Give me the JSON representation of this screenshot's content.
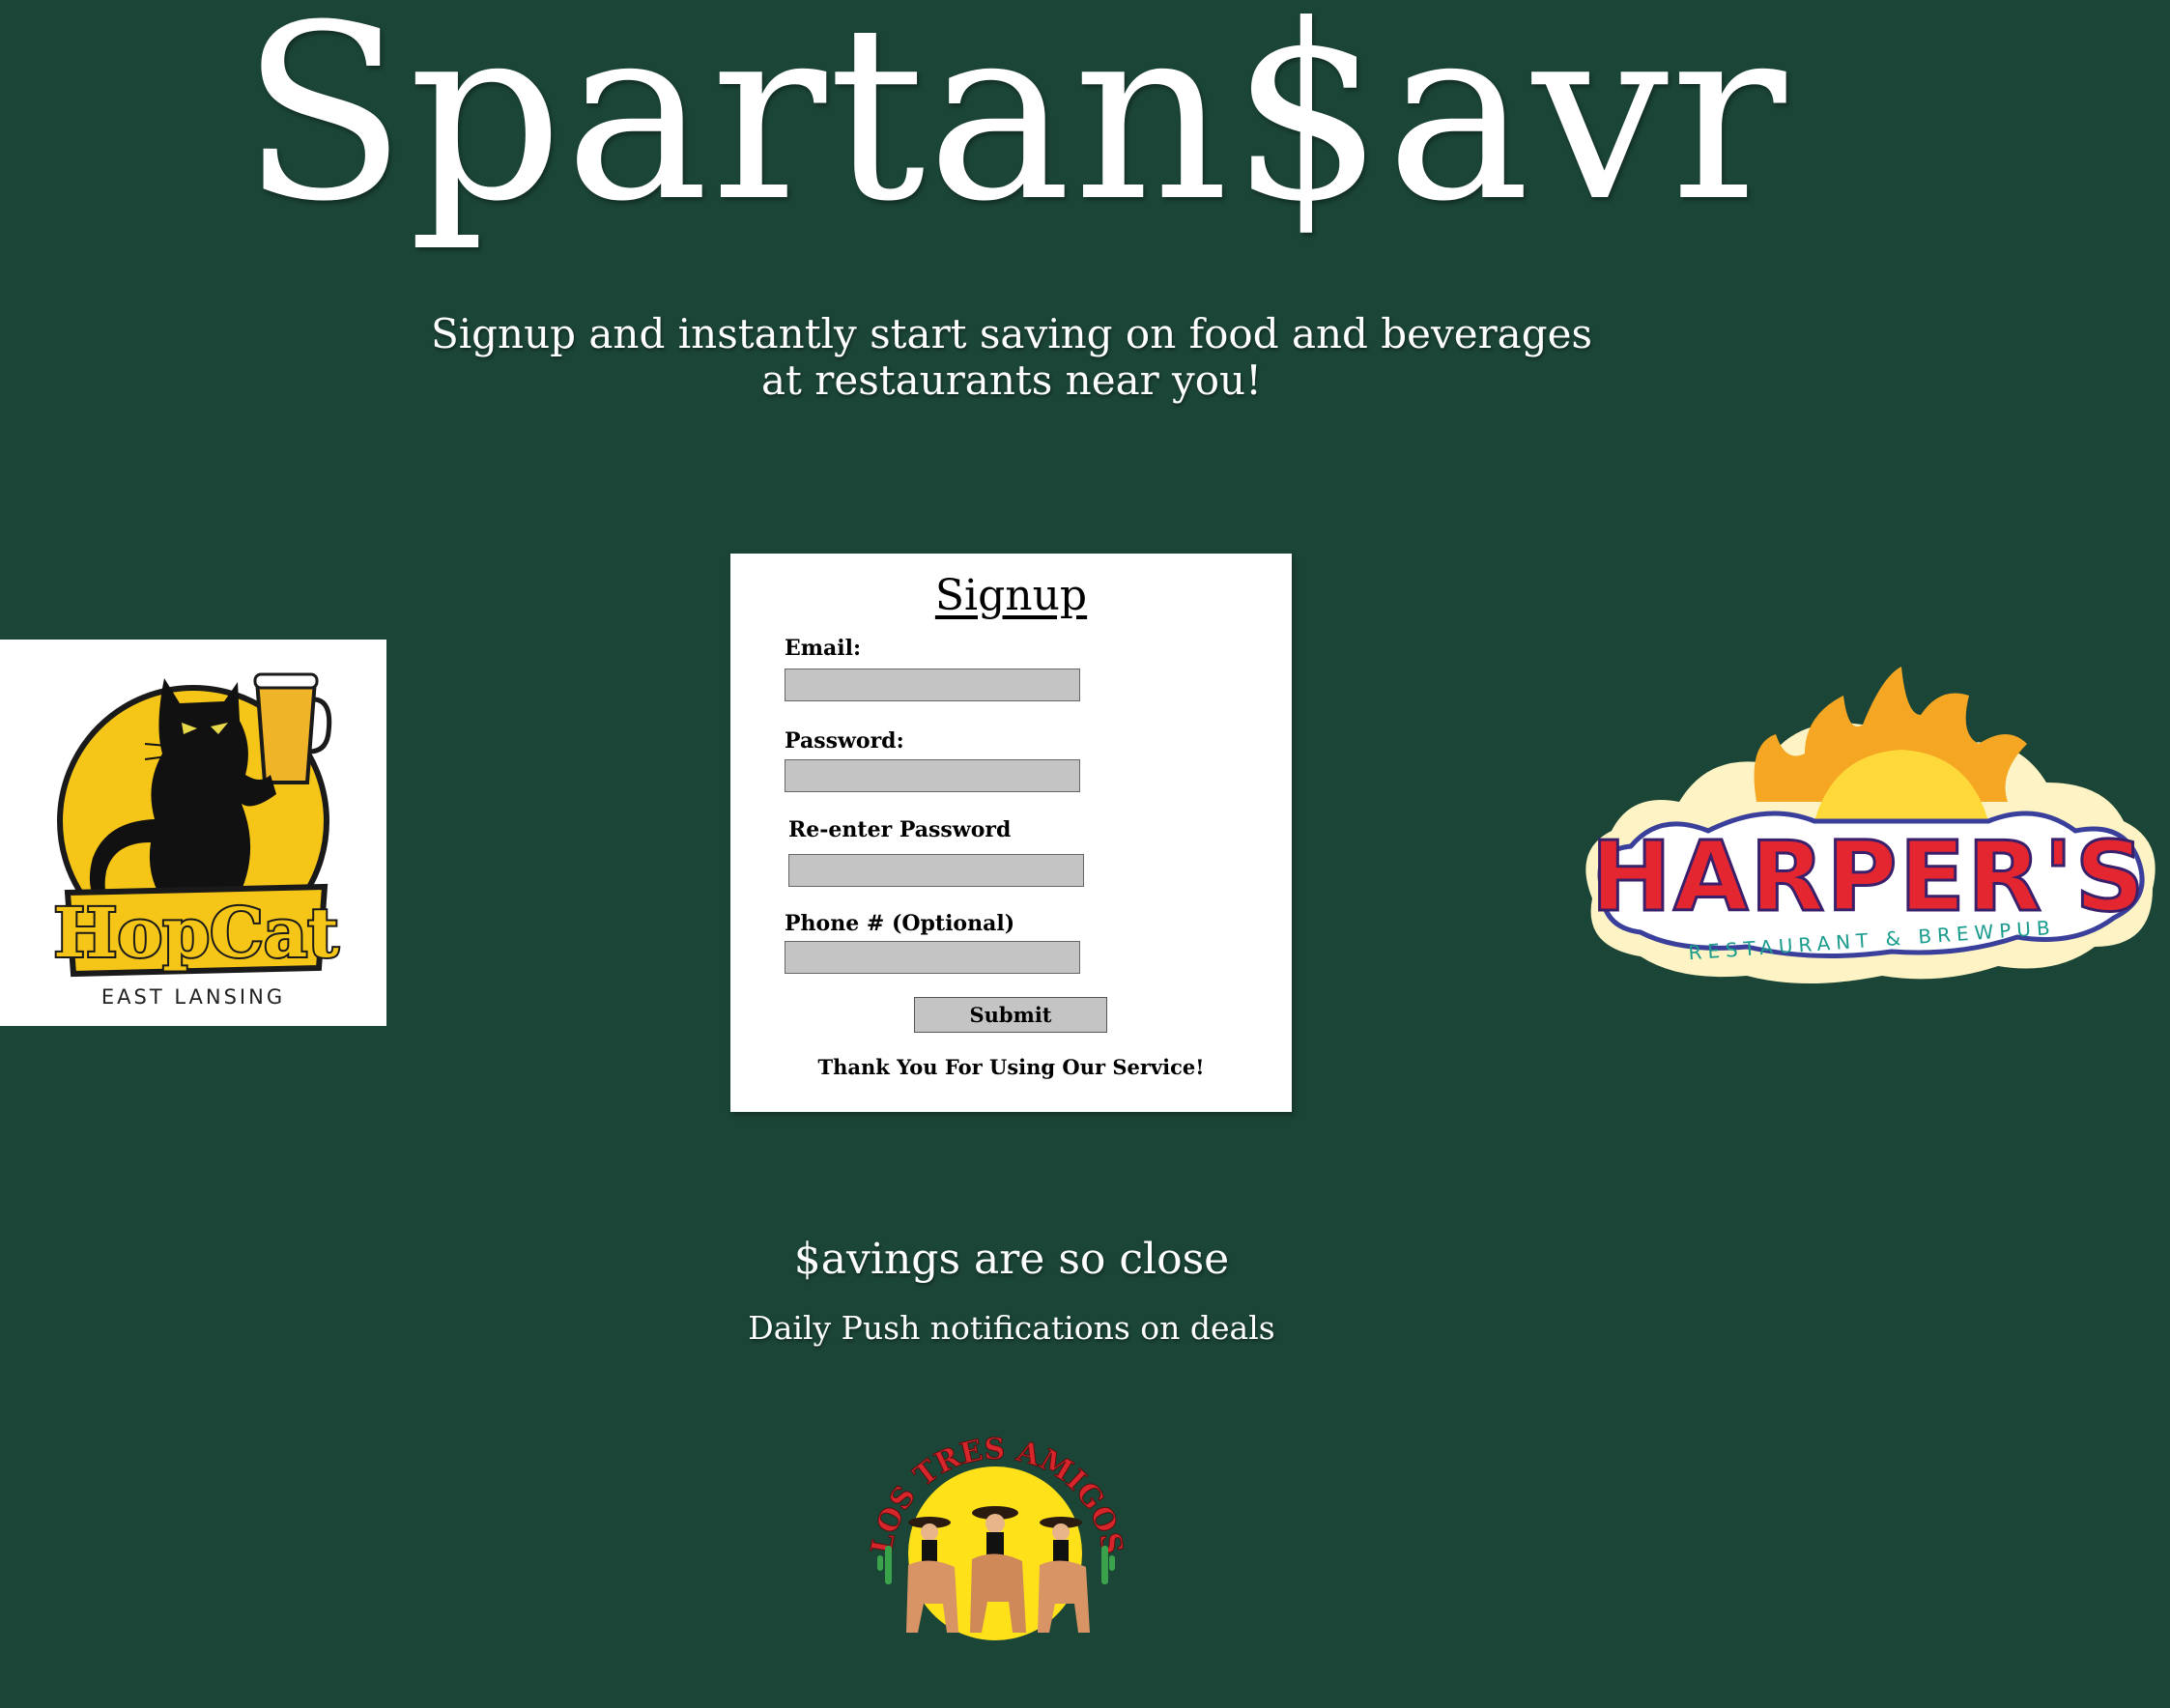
{
  "brand": {
    "title": "Spartan$avr"
  },
  "hero": {
    "tagline_line1": "Signup and instantly start saving on food and beverages",
    "tagline_line2": "at restaurants near you!"
  },
  "signup": {
    "title": "Signup",
    "email_label": "Email:",
    "email_value": "",
    "password_label": "Password:",
    "password_value": "",
    "reenter_label": "Re-enter Password",
    "reenter_value": "",
    "phone_label": "Phone # (Optional)",
    "phone_value": "",
    "submit_label": "Submit",
    "thank_you": "Thank You For Using Our Service!"
  },
  "features": {
    "heading": "$avings are so close",
    "subheading": "Daily Push notifications on deals"
  },
  "logos": {
    "hopcat": {
      "name": "HopCat",
      "location": "EAST LANSING"
    },
    "harpers": {
      "name": "HARPER'S",
      "tagline": "RESTAURANT & BREWPUB"
    },
    "lostres": {
      "name": "LOS TRES AMIGOS"
    }
  },
  "colors": {
    "background": "#1b4536",
    "card": "#ffffff",
    "input": "#c4c4c4",
    "hopcat_yellow": "#f5c518",
    "harpers_red": "#e3262f",
    "harpers_teal": "#1a9b8e",
    "lostres_red": "#d7262b"
  }
}
